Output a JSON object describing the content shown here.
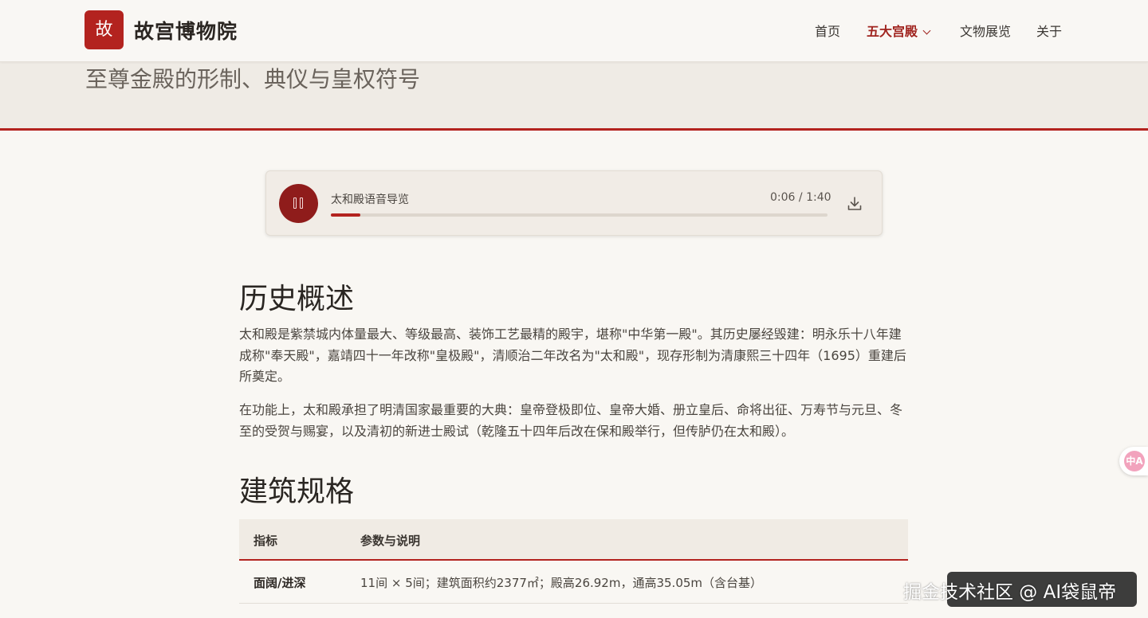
{
  "header": {
    "logo_char": "故",
    "site_title": "故宫博物院",
    "nav": [
      {
        "label": "首页",
        "active": false
      },
      {
        "label": "五大宫殿",
        "active": true,
        "dropdown": true
      },
      {
        "label": "文物展览",
        "active": false
      },
      {
        "label": "关于",
        "active": false
      }
    ]
  },
  "hero": {
    "subtitle": "至尊金殿的形制、典仪与皇权符号"
  },
  "player": {
    "title": "太和殿语音导览",
    "current_time": "0:06",
    "time_separator": "/",
    "duration": "1:40",
    "progress_fraction": 0.06,
    "state": "playing",
    "icons": {
      "play_pause": "pause-icon",
      "download": "download-icon"
    }
  },
  "sections": {
    "history": {
      "heading": "历史概述",
      "paragraphs": [
        "太和殿是紫禁城内体量最大、等级最高、装饰工艺最精的殿宇，堪称\"中华第一殿\"。其历史屡经毁建：明永乐十八年建成称\"奉天殿\"，嘉靖四十一年改称\"皇极殿\"，清顺治二年改名为\"太和殿\"，现存形制为清康熙三十四年（1695）重建后所奠定。",
        "在功能上，太和殿承担了明清国家最重要的大典：皇帝登极即位、皇帝大婚、册立皇后、命将出征、万寿节与元旦、冬至的受贺与赐宴，以及清初的新进士殿试（乾隆五十四年后改在保和殿举行，但传胪仍在太和殿）。"
      ]
    },
    "specs": {
      "heading": "建筑规格",
      "columns": [
        "指标",
        "参数与说明"
      ],
      "rows": [
        [
          "面阔/进深",
          "11间 × 5间；建筑面积约2377㎡；殿高26.92m，通高35.05m（含台基）"
        ]
      ]
    }
  },
  "side_widget": {
    "label": "中A"
  },
  "watermark": {
    "text": "掘金技术社区 @ AI袋鼠帝"
  },
  "colors": {
    "accent": "#b3231f",
    "play_button": "#8f1c1b",
    "background": "#f9f7f3",
    "hero_band": "#efebe5"
  }
}
